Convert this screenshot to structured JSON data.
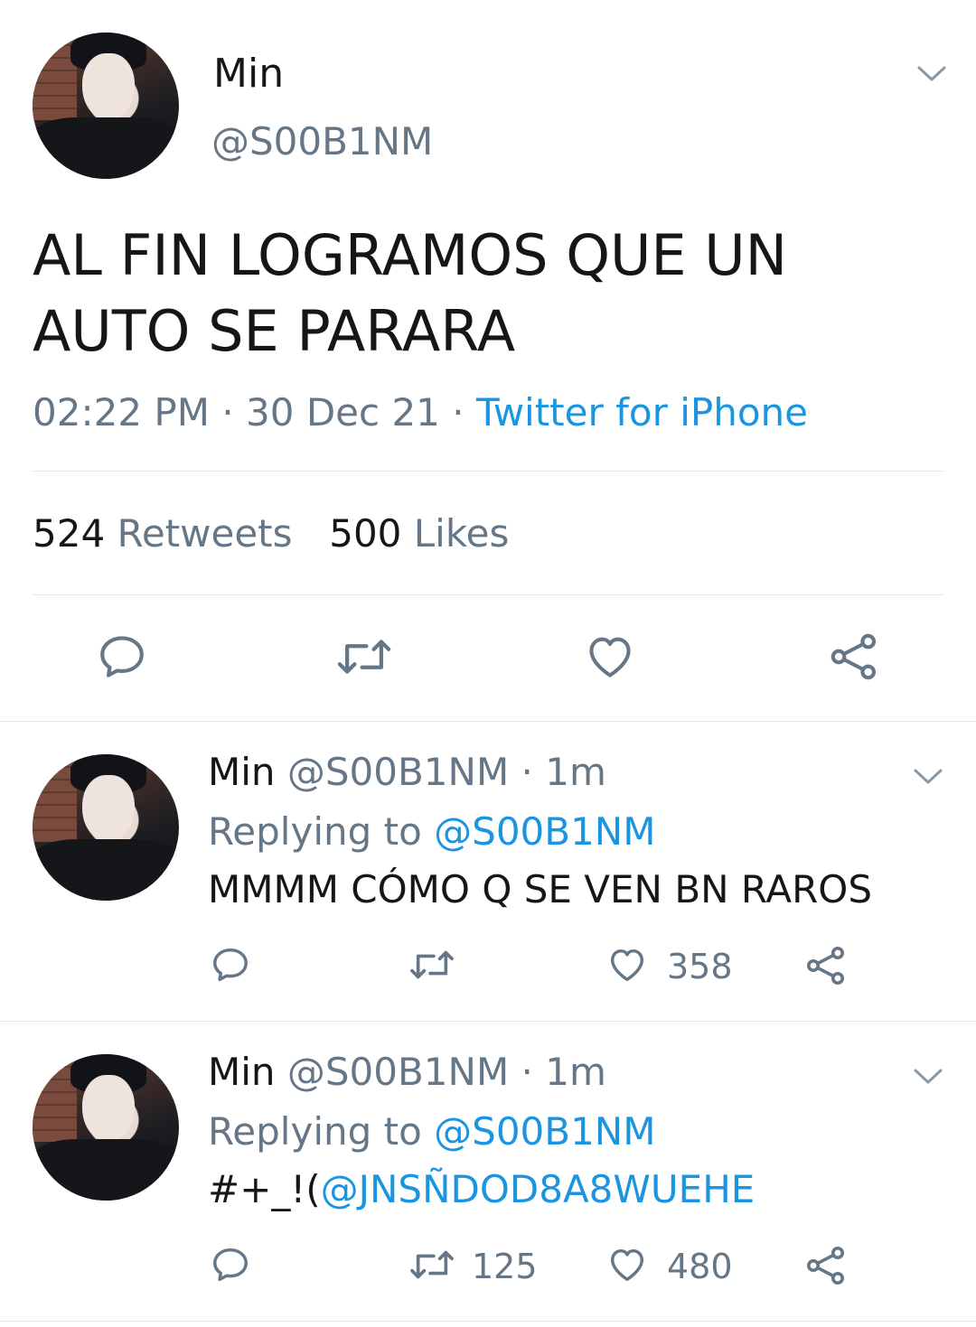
{
  "main_tweet": {
    "author_name": "Min",
    "handle": "@S00B1NM",
    "text_line1": "AL FIN LOGRAMOS QUE UN",
    "text_line2": "AUTO SE PARARA",
    "time": "02:22 PM",
    "dot1": "·",
    "date": "30 Dec 21",
    "dot2": "·",
    "source": "Twitter for iPhone",
    "retweets_count": "524",
    "retweets_label": "Retweets",
    "likes_count": "500",
    "likes_label": "Likes"
  },
  "replies": [
    {
      "author_name": "Min",
      "handle": "@S00B1NM",
      "dot": "·",
      "age": "1m",
      "replying_label": "Replying to",
      "replying_handle": "@S00B1NM",
      "text_plain": "MMMM CÓMO Q SE VEN BN RAROS",
      "text_link": "",
      "retweets": "",
      "likes": "358"
    },
    {
      "author_name": "Min",
      "handle": "@S00B1NM",
      "dot": "·",
      "age": "1m",
      "replying_label": "Replying to",
      "replying_handle": "@S00B1NM",
      "text_plain": "#+_!(",
      "text_link": "@JNSÑDOD8A8WUEHE",
      "retweets": "125",
      "likes": "480"
    }
  ],
  "icons": {
    "reply": "speech-bubble",
    "retweet": "retweet-arrows",
    "like": "heart-outline",
    "share": "share-nodes",
    "menu": "chevron-down"
  },
  "colors": {
    "text": "#14171a",
    "secondary": "#657786",
    "link": "#1b95e0",
    "divider": "#e1e8ed"
  }
}
